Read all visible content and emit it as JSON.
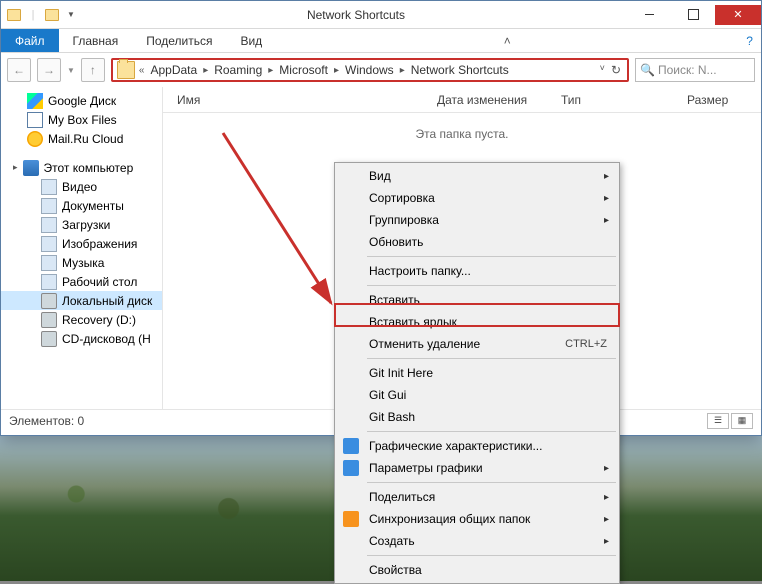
{
  "window": {
    "title": "Network Shortcuts"
  },
  "ribbon": {
    "file": "Файл",
    "tabs": [
      "Главная",
      "Поделиться",
      "Вид"
    ]
  },
  "breadcrumb": {
    "prefix": "«",
    "items": [
      "AppData",
      "Roaming",
      "Microsoft",
      "Windows",
      "Network Shortcuts"
    ]
  },
  "search": {
    "placeholder": "Поиск: N..."
  },
  "tree": {
    "items": [
      {
        "label": "Google Диск",
        "ico": "gdrive",
        "l": 1
      },
      {
        "label": "My Box Files",
        "ico": "box",
        "l": 1
      },
      {
        "label": "Mail.Ru Cloud",
        "ico": "mailru",
        "l": 1
      }
    ],
    "pc_label": "Этот компьютер",
    "pc_items": [
      {
        "label": "Видео",
        "ico": "generic"
      },
      {
        "label": "Документы",
        "ico": "generic"
      },
      {
        "label": "Загрузки",
        "ico": "generic"
      },
      {
        "label": "Изображения",
        "ico": "generic"
      },
      {
        "label": "Музыка",
        "ico": "generic"
      },
      {
        "label": "Рабочий стол",
        "ico": "generic"
      },
      {
        "label": "Локальный диск",
        "ico": "disk",
        "sel": true
      },
      {
        "label": "Recovery (D:)",
        "ico": "disk"
      },
      {
        "label": "CD-дисковод (H",
        "ico": "disk"
      }
    ]
  },
  "columns": {
    "name": "Имя",
    "date": "Дата изменения",
    "type": "Тип",
    "size": "Размер"
  },
  "empty": "Эта папка пуста.",
  "status": {
    "label": "Элементов: 0"
  },
  "ctx": {
    "groups": [
      [
        {
          "label": "Вид",
          "arrow": true
        },
        {
          "label": "Сортировка",
          "arrow": true
        },
        {
          "label": "Группировка",
          "arrow": true
        },
        {
          "label": "Обновить"
        }
      ],
      [
        {
          "label": "Настроить папку..."
        }
      ],
      [
        {
          "label": "Вставить"
        },
        {
          "label": "Вставить ярлык",
          "hl": true
        },
        {
          "label": "Отменить удаление",
          "short": "CTRL+Z"
        }
      ],
      [
        {
          "label": "Git Init Here"
        },
        {
          "label": "Git Gui"
        },
        {
          "label": "Git Bash"
        }
      ],
      [
        {
          "label": "Графические характеристики...",
          "ico": "blue"
        },
        {
          "label": "Параметры графики",
          "arrow": true,
          "ico": "blue"
        }
      ],
      [
        {
          "label": "Поделиться",
          "arrow": true
        },
        {
          "label": "Синхронизация общих папок",
          "arrow": true,
          "ico": "orange"
        },
        {
          "label": "Создать",
          "arrow": true
        }
      ],
      [
        {
          "label": "Свойства"
        }
      ]
    ]
  }
}
